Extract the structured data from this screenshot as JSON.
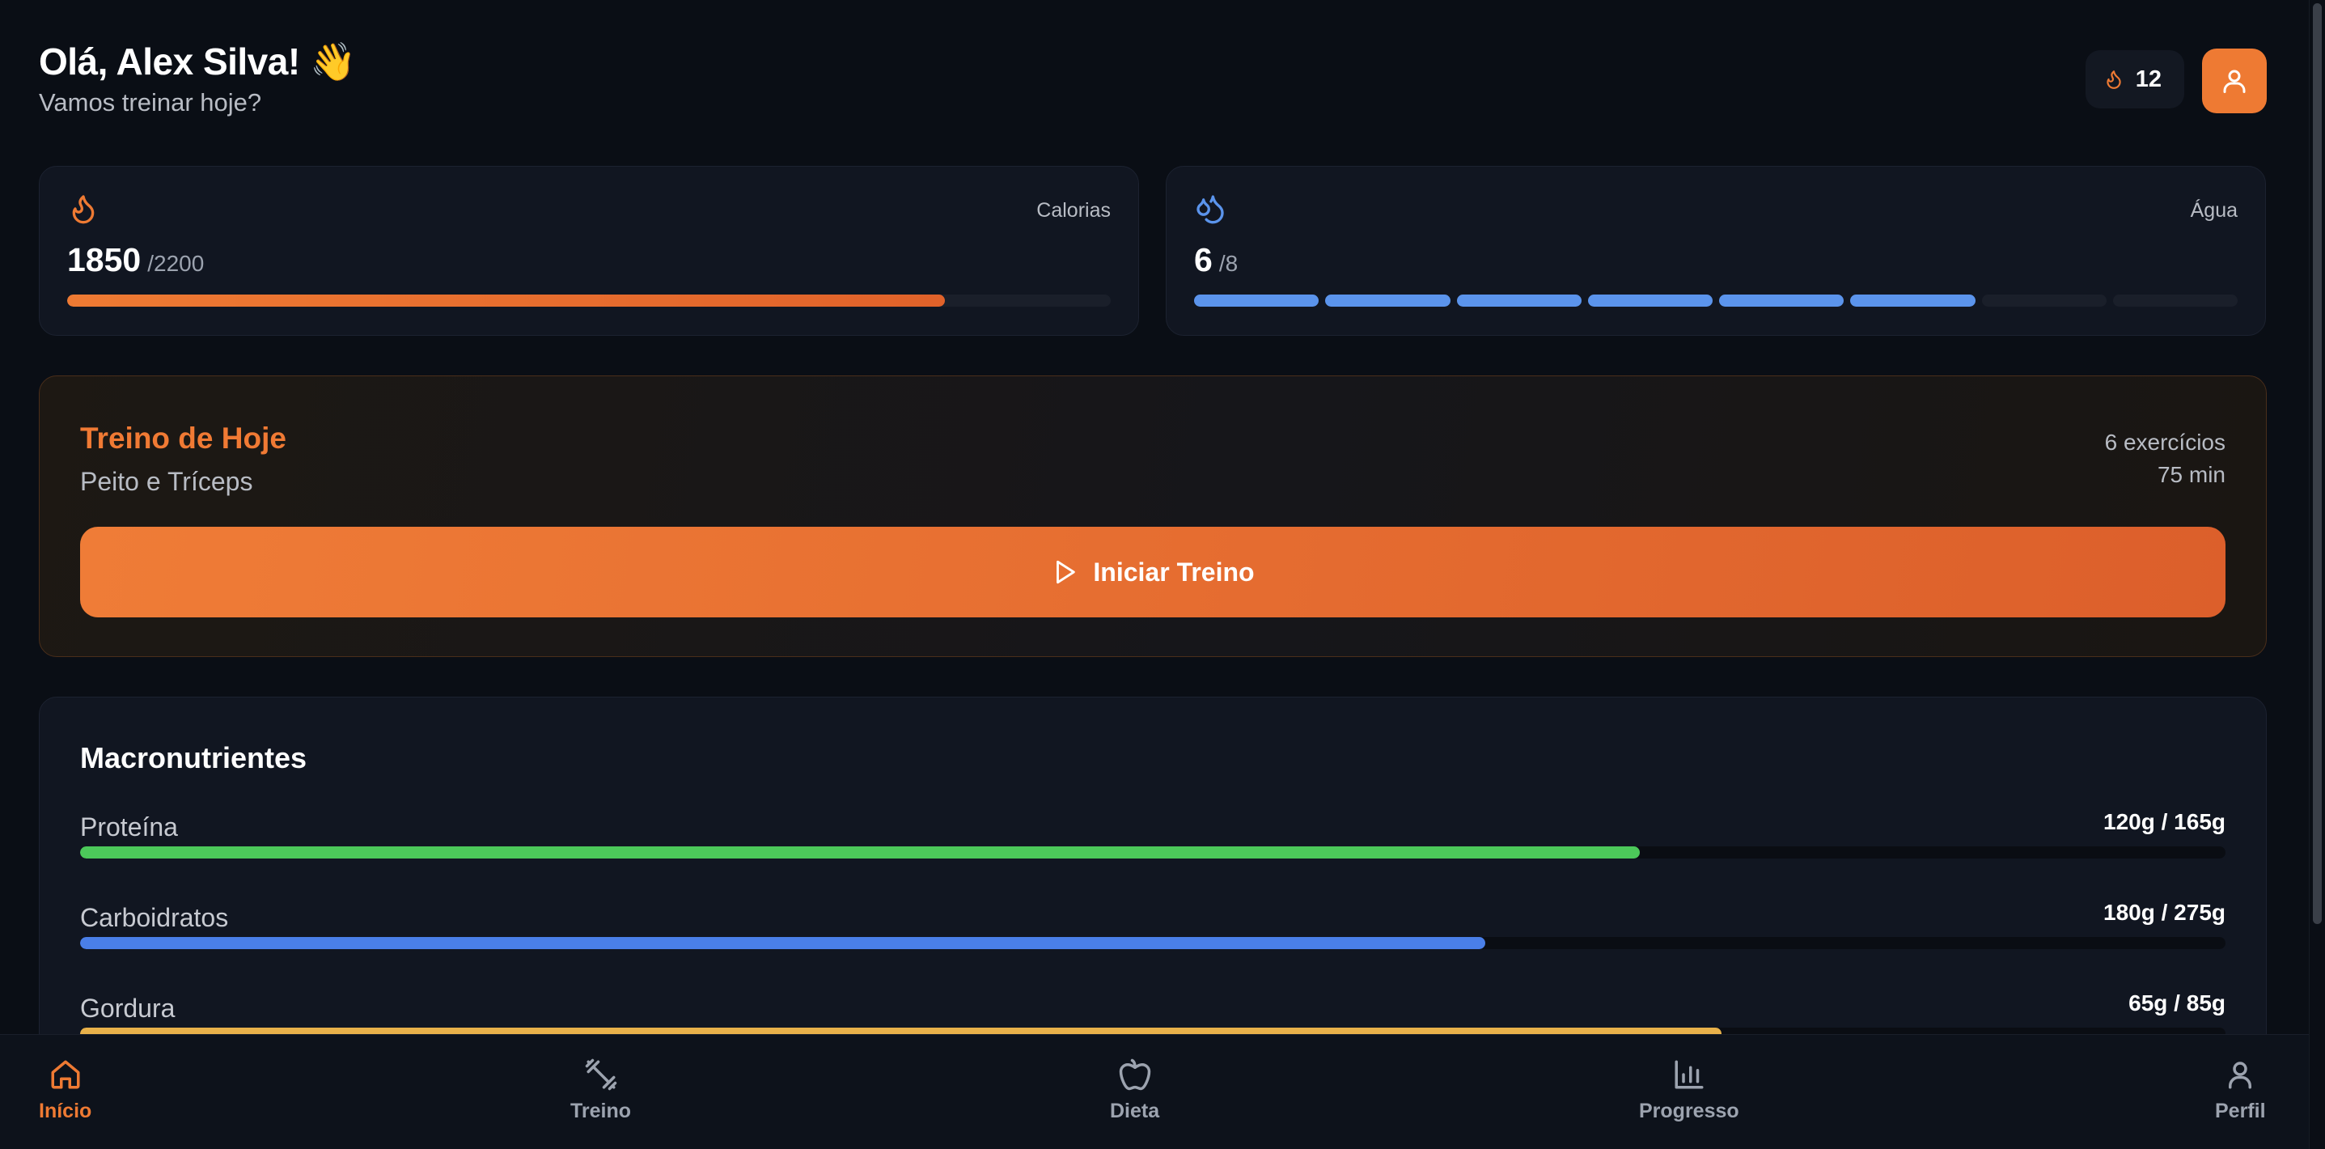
{
  "header": {
    "greeting": "Olá, Alex Silva! 👋",
    "subtitle": "Vamos treinar hoje?",
    "streak_count": "12"
  },
  "calories": {
    "label": "Calorias",
    "value": "1850",
    "goal": "/2200",
    "progress_fraction": 0.841
  },
  "water": {
    "label": "Água",
    "value": "6",
    "goal": "/8",
    "filled_segments": 6,
    "total_segments": 8
  },
  "workout": {
    "title": "Treino de Hoje",
    "subtitle": "Peito e Tríceps",
    "exercises": "6 exercícios",
    "duration": "75 min",
    "start_label": "Iniciar Treino"
  },
  "macros": {
    "title": "Macronutrientes",
    "items": [
      {
        "name": "Proteína",
        "amount": "120g / 165g",
        "fraction": 0.727,
        "color": "#4cc95a"
      },
      {
        "name": "Carboidratos",
        "amount": "180g / 275g",
        "fraction": 0.655,
        "color": "#4a7fe8"
      },
      {
        "name": "Gordura",
        "amount": "65g / 85g",
        "fraction": 0.765,
        "color": "#e8b14a"
      }
    ]
  },
  "nav": {
    "items": [
      {
        "label": "Início",
        "icon": "home-icon",
        "active": true
      },
      {
        "label": "Treino",
        "icon": "dumbbell-icon",
        "active": false
      },
      {
        "label": "Dieta",
        "icon": "apple-icon",
        "active": false
      },
      {
        "label": "Progresso",
        "icon": "bar-chart-icon",
        "active": false
      },
      {
        "label": "Perfil",
        "icon": "user-icon",
        "active": false
      }
    ]
  },
  "colors": {
    "accent": "#ee7a33",
    "water": "#5b94ec",
    "background": "#0a0e15"
  }
}
